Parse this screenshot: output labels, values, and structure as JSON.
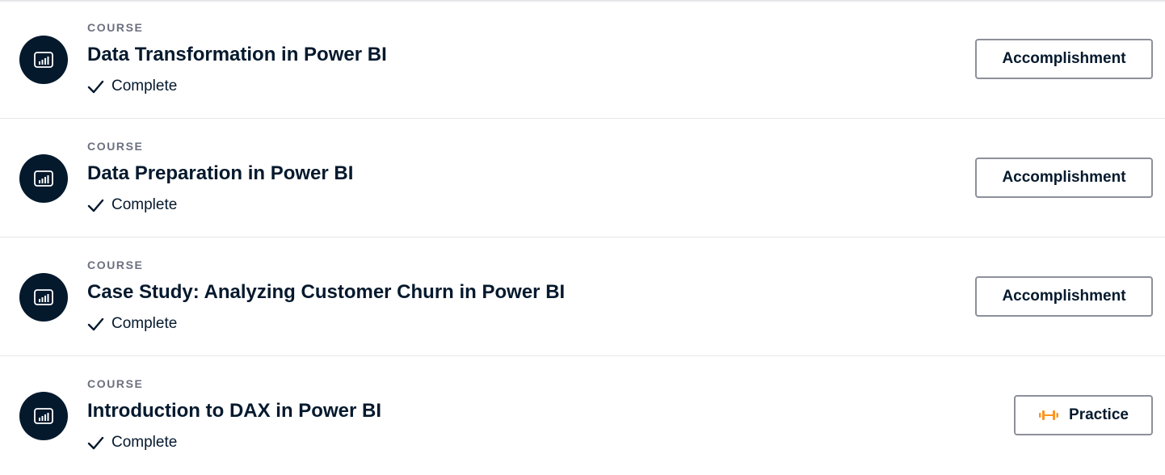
{
  "courses": [
    {
      "type_label": "COURSE",
      "title": "Data Transformation in Power BI",
      "status": "Complete",
      "action_label": "Accomplishment",
      "icon": "power-bi-icon"
    },
    {
      "type_label": "COURSE",
      "title": "Data Preparation in Power BI",
      "status": "Complete",
      "action_label": "Accomplishment",
      "icon": "power-bi-icon"
    },
    {
      "type_label": "COURSE",
      "title": "Case Study: Analyzing Customer Churn in Power BI",
      "status": "Complete",
      "action_label": "Accomplishment",
      "icon": "power-bi-icon"
    },
    {
      "type_label": "COURSE",
      "title": "Introduction to DAX in Power BI",
      "status": "Complete",
      "action_label": "Practice",
      "icon": "power-bi-icon",
      "action_icon": "dumbbell-icon"
    }
  ],
  "colors": {
    "navy": "#05192d",
    "muted": "#6b7080",
    "button_border": "#8d909a",
    "practice_accent": "#ff931e"
  }
}
